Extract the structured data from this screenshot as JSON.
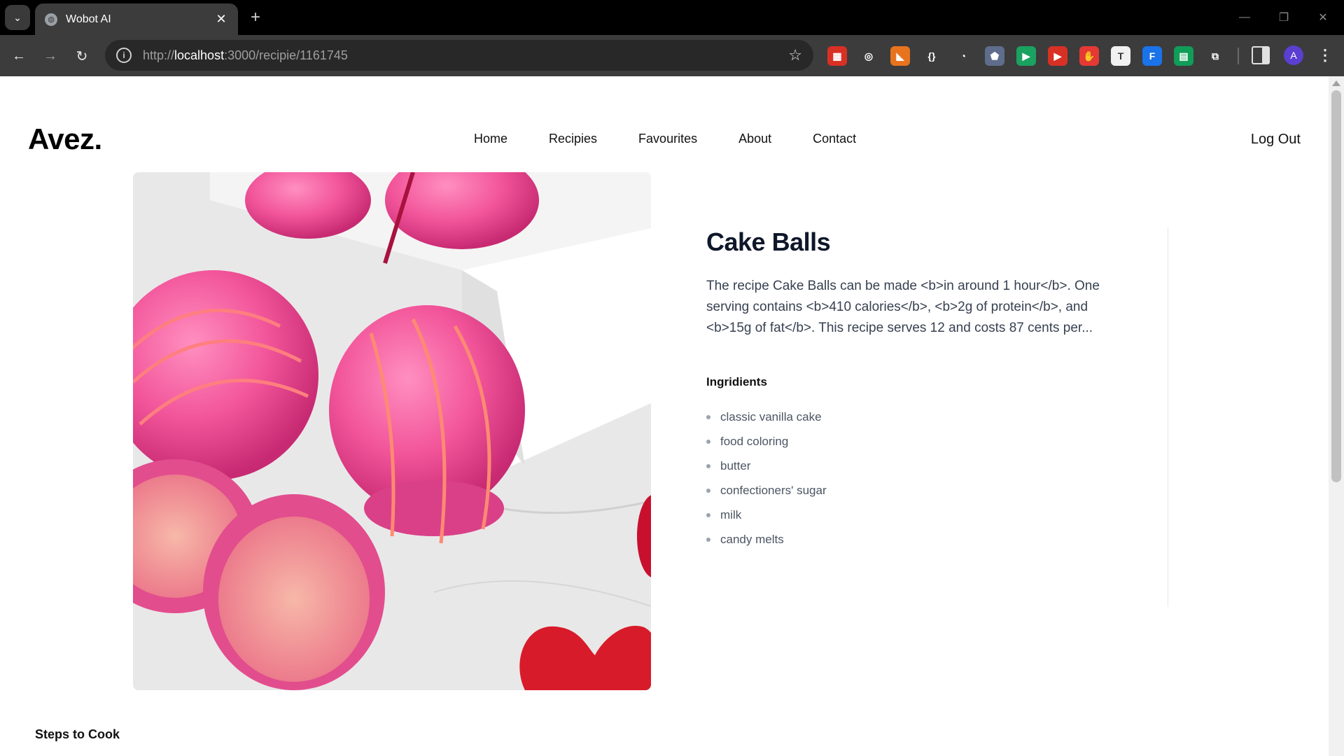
{
  "browser": {
    "tab_title": "Wobot AI",
    "url_scheme": "http://",
    "url_host": "localhost",
    "url_path": ":3000/recipie/1161745"
  },
  "extensions": [
    {
      "name": "ext-red-grid-icon",
      "color": "#d93025",
      "glyph": "▦"
    },
    {
      "name": "ext-target-icon",
      "color": "#3c3c3c",
      "glyph": "◎"
    },
    {
      "name": "ext-fox-icon",
      "color": "#e8731f",
      "glyph": "◣"
    },
    {
      "name": "ext-braces-icon",
      "color": "#3c3c3c",
      "glyph": "{}"
    },
    {
      "name": "ext-timer-icon",
      "color": "#3c3c3c",
      "glyph": "◔"
    },
    {
      "name": "ext-shield-icon",
      "color": "#5f6d8c",
      "glyph": "⬟"
    },
    {
      "name": "ext-play-green-icon",
      "color": "#1aa260",
      "glyph": "▶"
    },
    {
      "name": "ext-play-red-icon",
      "color": "#d93025",
      "glyph": "▶"
    },
    {
      "name": "ext-hand-icon",
      "color": "#e53935",
      "glyph": "✋"
    },
    {
      "name": "ext-text-icon",
      "color": "#f1f1f1",
      "glyph": "T"
    },
    {
      "name": "ext-f-icon",
      "color": "#1a73e8",
      "glyph": "F"
    },
    {
      "name": "ext-sheet-icon",
      "color": "#0f9d58",
      "glyph": "▤"
    },
    {
      "name": "ext-puzzle-icon",
      "color": "#3c3c3c",
      "glyph": "⧉"
    }
  ],
  "profile_initial": "A",
  "site": {
    "logo": "Avez.",
    "nav": [
      "Home",
      "Recipies",
      "Favourites",
      "About",
      "Contact"
    ],
    "logout": "Log Out"
  },
  "recipe": {
    "title": "Cake Balls",
    "summary": "The recipe Cake Balls can be made <b>in around 1 hour</b>. One serving contains <b>410 calories</b>, <b>2g of protein</b>, and <b>15g of fat</b>. This recipe serves 12 and costs 87 cents per...",
    "ingredients_heading": "Ingridients",
    "ingredients": [
      "classic vanilla cake",
      "food coloring",
      "butter",
      "confectioners' sugar",
      "milk",
      "candy melts"
    ],
    "steps_heading": "Steps to Cook"
  },
  "colors": {
    "chrome_bg": "#000000",
    "toolbar_bg": "#3c3c3c",
    "title_color": "#0f172a",
    "cake_pink": "#f0609a",
    "heart_red": "#d81b2a"
  }
}
